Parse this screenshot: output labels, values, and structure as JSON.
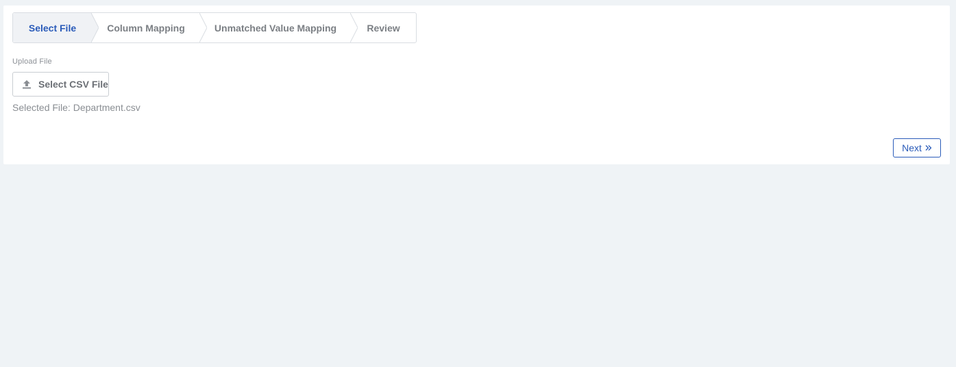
{
  "wizard": {
    "steps": [
      {
        "label": "Select File",
        "active": true
      },
      {
        "label": "Column Mapping",
        "active": false
      },
      {
        "label": "Unmatched Value Mapping",
        "active": false
      },
      {
        "label": "Review",
        "active": false
      }
    ]
  },
  "upload": {
    "field_label": "Upload File",
    "button_label": "Select CSV File",
    "button_icon": "upload-icon",
    "selected_file_text": "Selected File: Department.csv"
  },
  "footer": {
    "next_label": "Next",
    "next_icon": "double-chevron-right-icon"
  },
  "colors": {
    "accent": "#2a5bb9",
    "page_background": "#eff3f6",
    "active_step_background": "#f0f2f5"
  }
}
